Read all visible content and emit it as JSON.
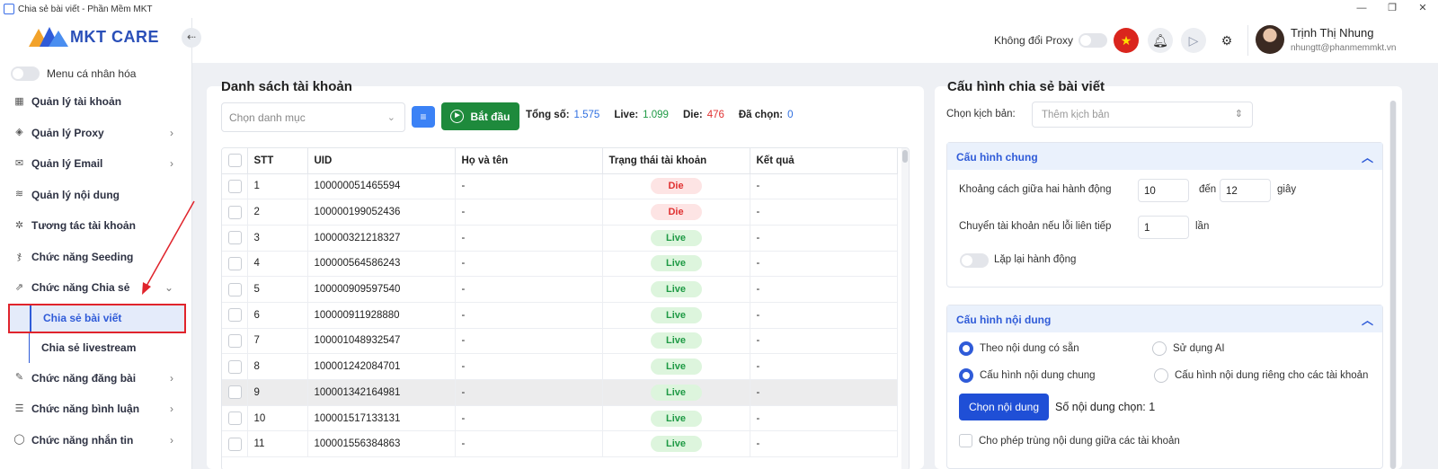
{
  "window": {
    "title": "Chia sẻ bài viết - Phần Mềm MKT",
    "controls": [
      "—",
      "❐",
      "✕"
    ]
  },
  "sidebar": {
    "logo_text": "MKT CARE",
    "collapse_icon": "arrow-left-icon",
    "menu_toggle_label": "Menu cá nhân hóa",
    "items": [
      {
        "label": "Quản lý tài khoản",
        "icon": "grid-icon",
        "has_chevron": false
      },
      {
        "label": "Quản lý Proxy",
        "icon": "layers-icon",
        "has_chevron": true
      },
      {
        "label": "Quản lý Email",
        "icon": "mail-icon",
        "has_chevron": true
      },
      {
        "label": "Quản lý nội dung",
        "icon": "content-icon",
        "has_chevron": false
      },
      {
        "label": "Tương tác tài khoản",
        "icon": "sparkle-icon",
        "has_chevron": false
      },
      {
        "label": "Chức năng Seeding",
        "icon": "seeding-icon",
        "has_chevron": false
      },
      {
        "label": "Chức năng Chia sẻ",
        "icon": "share-icon",
        "has_chevron": true,
        "expanded": true
      }
    ],
    "sub_items": [
      {
        "label": "Chia sẻ bài viết",
        "active": true
      },
      {
        "label": "Chia sẻ livestream",
        "active": false
      }
    ],
    "items_after": [
      {
        "label": "Chức năng đăng bài",
        "icon": "post-icon",
        "has_chevron": true
      },
      {
        "label": "Chức năng bình luận",
        "icon": "comment-icon",
        "has_chevron": true
      },
      {
        "label": "Chức năng nhắn tin",
        "icon": "message-icon",
        "has_chevron": true
      }
    ]
  },
  "header": {
    "proxy_label": "Không đổi Proxy",
    "icons": [
      "vietnam-flag-icon",
      "bell-icon",
      "play-icon",
      "gear-icon"
    ],
    "user_name": "Trịnh Thị Nhung",
    "user_email": "nhungtt@phanmemmkt.vn"
  },
  "accounts": {
    "title": "Danh sách tài khoản",
    "category_placeholder": "Chọn danh mục",
    "start_label": "Bắt đầu",
    "stats": {
      "total_label": "Tổng số:",
      "total": "1.575",
      "live_label": "Live:",
      "live": "1.099",
      "die_label": "Die:",
      "die": "476",
      "selected_label": "Đã chọn:",
      "selected": "0"
    },
    "columns": [
      "STT",
      "UID",
      "Họ và tên",
      "Trạng thái tài khoản",
      "Kết quả"
    ],
    "rows": [
      {
        "stt": "1",
        "uid": "100000051465594",
        "name": "-",
        "status": "Die",
        "result": "-"
      },
      {
        "stt": "2",
        "uid": "100000199052436",
        "name": "-",
        "status": "Die",
        "result": "-"
      },
      {
        "stt": "3",
        "uid": "100000321218327",
        "name": "-",
        "status": "Live",
        "result": "-"
      },
      {
        "stt": "4",
        "uid": "100000564586243",
        "name": "-",
        "status": "Live",
        "result": "-"
      },
      {
        "stt": "5",
        "uid": "100000909597540",
        "name": "-",
        "status": "Live",
        "result": "-"
      },
      {
        "stt": "6",
        "uid": "100000911928880",
        "name": "-",
        "status": "Live",
        "result": "-"
      },
      {
        "stt": "7",
        "uid": "100001048932547",
        "name": "-",
        "status": "Live",
        "result": "-"
      },
      {
        "stt": "8",
        "uid": "100001242084701",
        "name": "-",
        "status": "Live",
        "result": "-"
      },
      {
        "stt": "9",
        "uid": "100001342164981",
        "name": "-",
        "status": "Live",
        "result": "-",
        "highlighted": true
      },
      {
        "stt": "10",
        "uid": "100001517133131",
        "name": "-",
        "status": "Live",
        "result": "-"
      },
      {
        "stt": "11",
        "uid": "100001556384863",
        "name": "-",
        "status": "Live",
        "result": "-"
      }
    ]
  },
  "config": {
    "title": "Cấu hình chia sẻ bài viết",
    "script_label": "Chọn kịch bản:",
    "script_placeholder": "Thêm kịch bản",
    "general": {
      "header": "Cấu hình chung",
      "interval_label": "Khoảng cách giữa hai hành động",
      "interval_from": "10",
      "to_label": "đến",
      "interval_to": "12",
      "unit_seconds": "giây",
      "switch_label": "Chuyển tài khoản nếu lỗi liên tiếp",
      "switch_value": "1",
      "unit_times": "lần",
      "repeat_label": "Lặp lại hành động"
    },
    "content": {
      "header": "Cấu hình nội dung",
      "opt_existing": "Theo nội dung có sẵn",
      "opt_ai": "Sử dụng AI",
      "opt_common": "Cấu hình nội dung chung",
      "opt_per_account": "Cấu hình nội dung riêng cho các tài khoản",
      "choose_button": "Chọn nội dung",
      "count_label": "Số nội dung chọn: 1",
      "allow_dup_label": "Cho phép trùng nội dung giữa các tài khoản"
    }
  },
  "colors": {
    "accent": "#2f5bd8",
    "start_green": "#1e8a3c",
    "die_red": "#e03131",
    "live_green": "#1f9a45"
  }
}
